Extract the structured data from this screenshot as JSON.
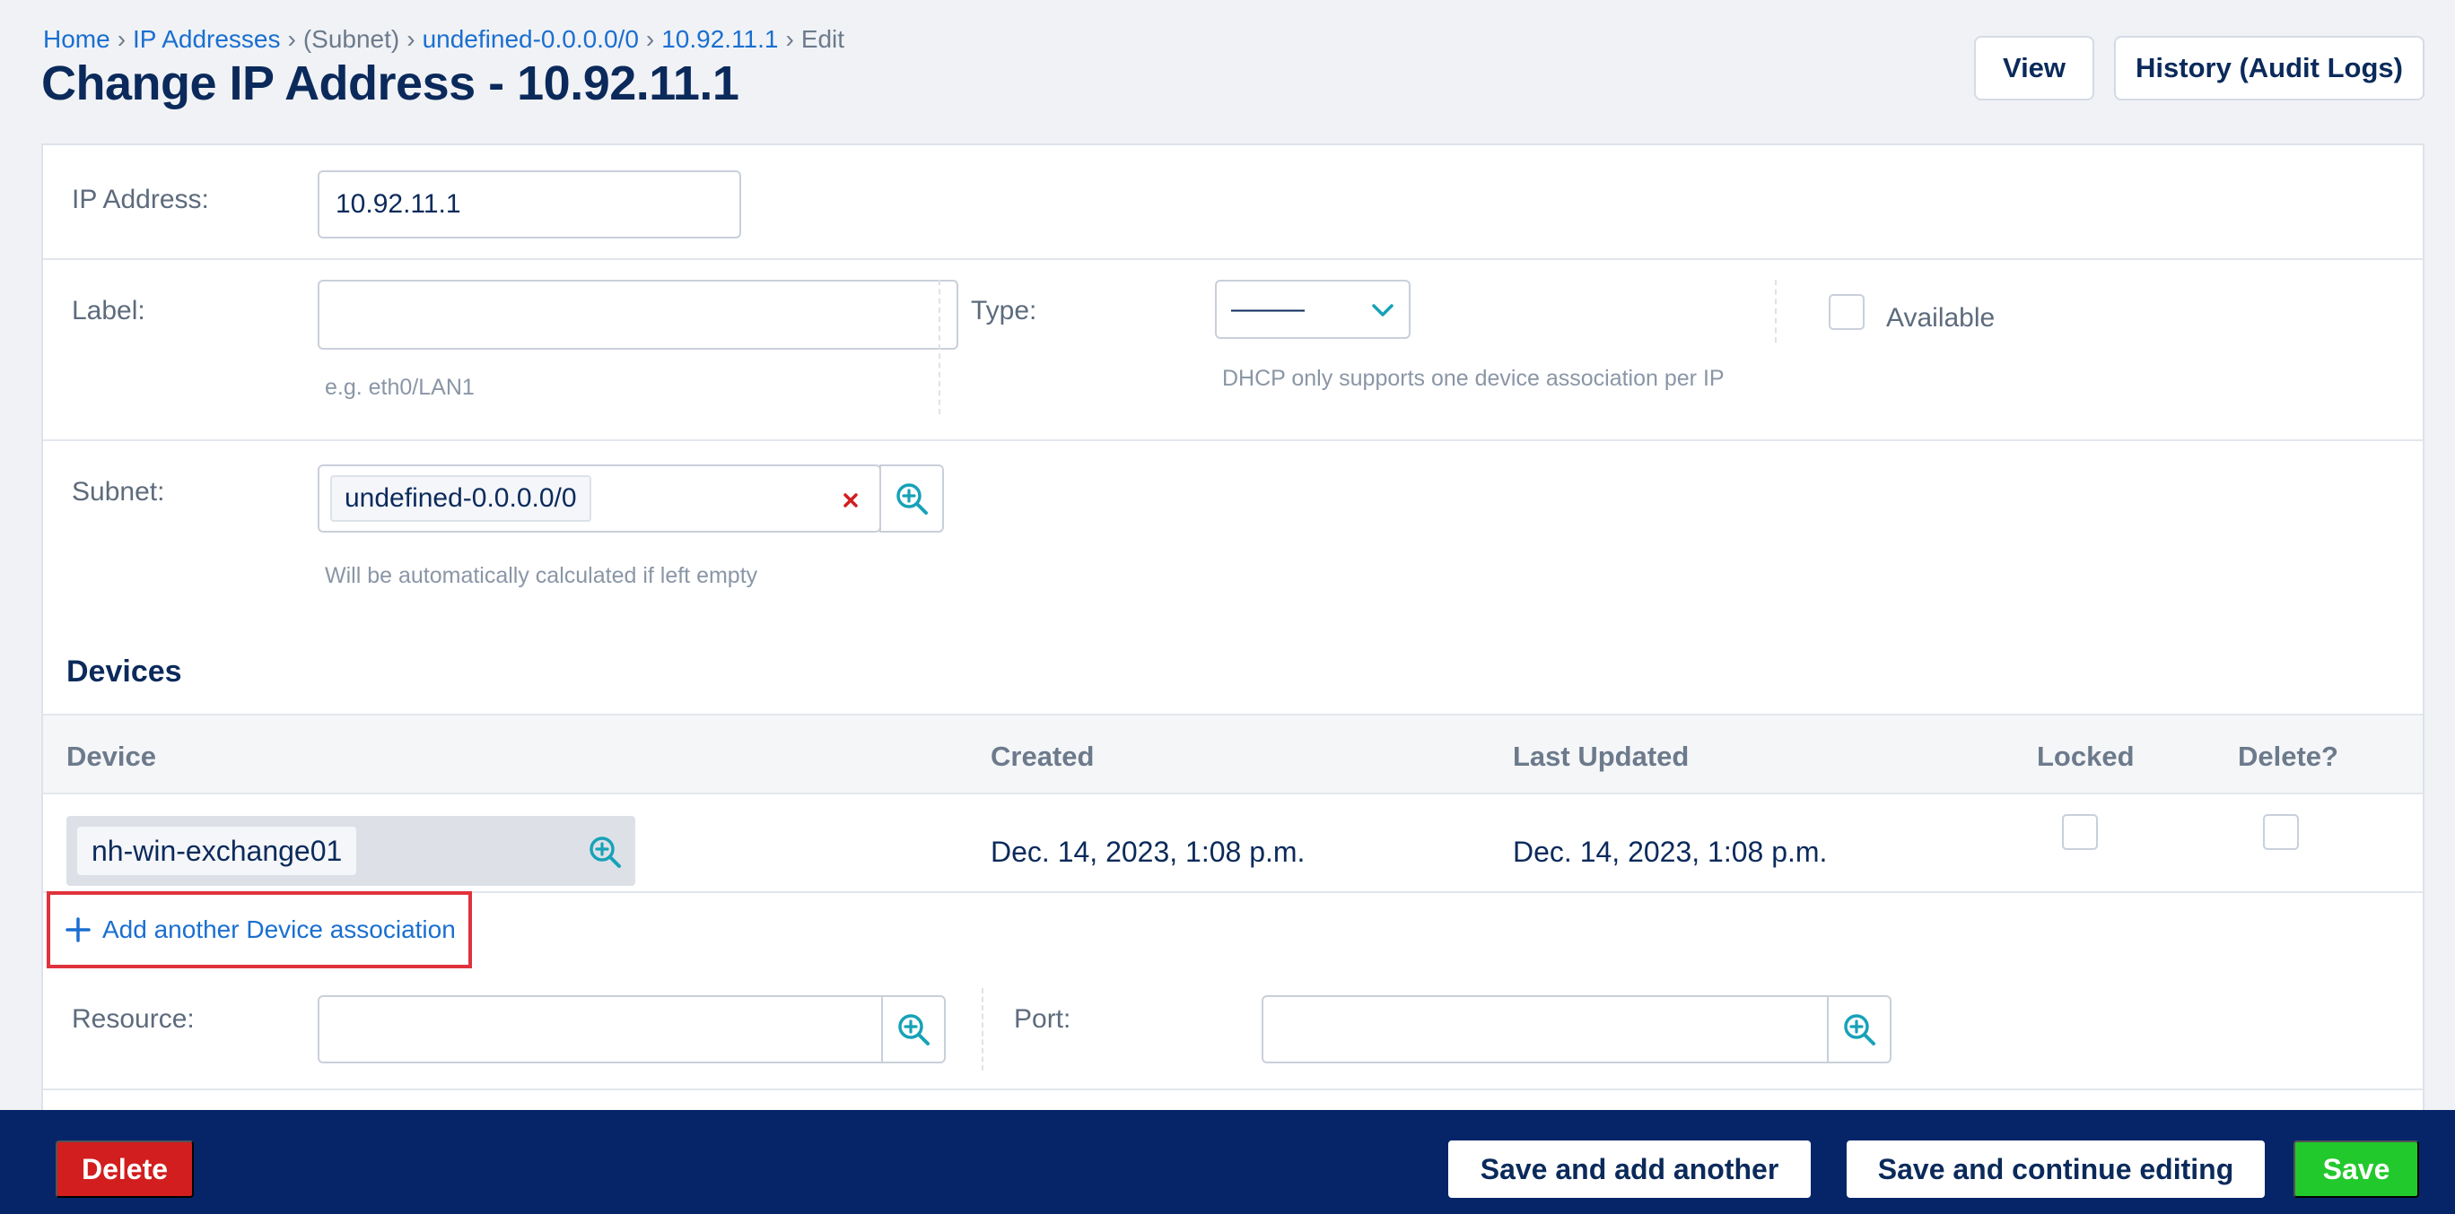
{
  "breadcrumb": {
    "home": "Home",
    "ip_addresses": "IP Addresses",
    "subnet_paren": "(Subnet)",
    "subnet": "undefined-0.0.0.0/0",
    "ip": "10.92.11.1",
    "current": "Edit"
  },
  "header": {
    "title": "Change IP Address - 10.92.11.1",
    "view_label": "View",
    "history_label": "History (Audit Logs)"
  },
  "form": {
    "ip_address_label": "IP Address:",
    "ip_address_value": "10.92.11.1",
    "label_label": "Label:",
    "label_value": "",
    "label_help": "e.g. eth0/LAN1",
    "type_label": "Type:",
    "type_value": "———",
    "type_help": "DHCP only supports one device association per IP",
    "available_label": "Available",
    "subnet_label": "Subnet:",
    "subnet_value": "undefined-0.0.0.0/0",
    "subnet_help": "Will be automatically calculated if left empty",
    "resource_label": "Resource:",
    "port_label": "Port:"
  },
  "devices": {
    "title": "Devices",
    "columns": [
      "Device",
      "Created",
      "Last Updated",
      "Locked",
      "Delete?"
    ],
    "rows": [
      {
        "device": "nh-win-exchange01",
        "created": "Dec. 14, 2023, 1:08 p.m.",
        "last_updated": "Dec. 14, 2023, 1:08 p.m."
      }
    ],
    "add_label": "Add another Device association"
  },
  "footer": {
    "delete_label": "Delete",
    "save_add_label": "Save and add another",
    "save_continue_label": "Save and continue editing",
    "save_label": "Save"
  },
  "colors": {
    "primary_dark": "#0b2a5b",
    "link": "#1a6fd0",
    "accent_teal": "#17a2b8",
    "footer_bg": "#062569",
    "delete": "#d21e1e",
    "save": "#22c92c",
    "highlight": "#e0323c"
  },
  "icons": [
    "zoom-in-icon",
    "clear-x-icon",
    "chevron-down-icon",
    "plus-icon"
  ]
}
